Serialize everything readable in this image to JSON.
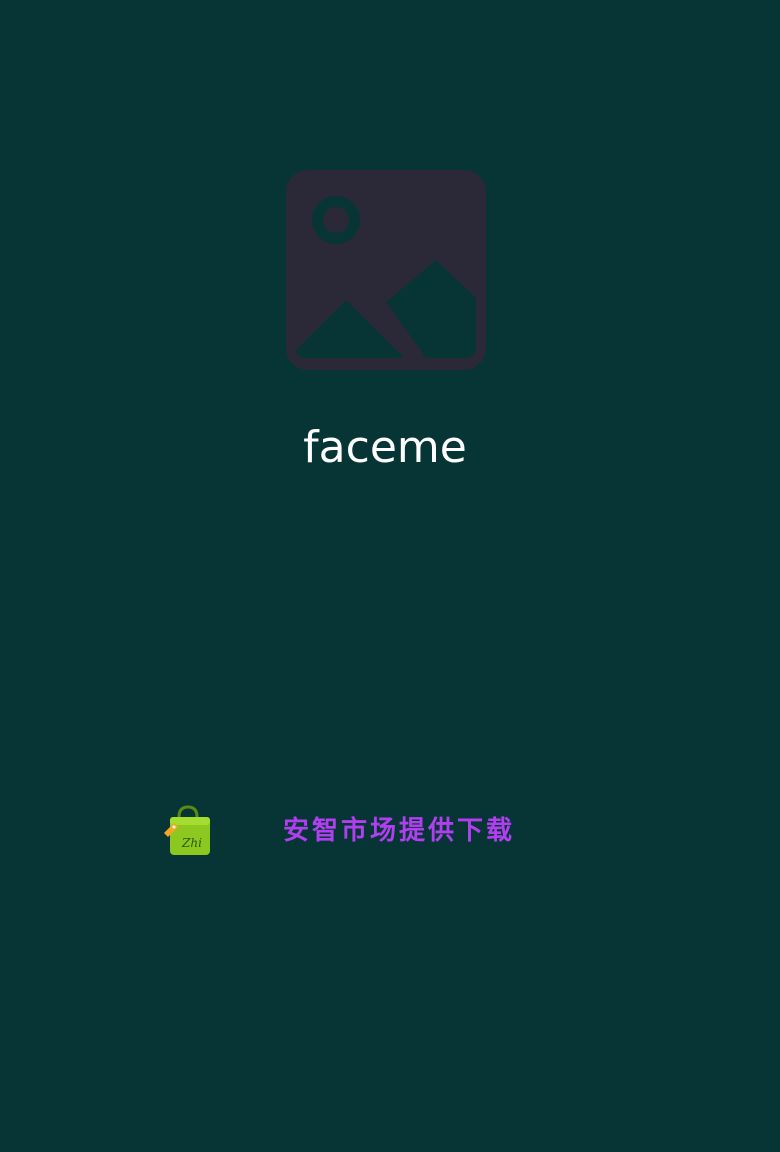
{
  "app": {
    "name": "faceme",
    "placeholder_icon": "image-placeholder-icon"
  },
  "footer": {
    "market_logo_icon": "shopping-bag-icon",
    "market_logo_text": "Zhi",
    "market_text": "安智市场提供下载"
  },
  "colors": {
    "background": "#073536",
    "placeholder": "#2b2937",
    "title": "#ffffff",
    "market_text": "#b03ff0",
    "bag_green": "#8cc820",
    "tag_orange": "#f5a623"
  }
}
